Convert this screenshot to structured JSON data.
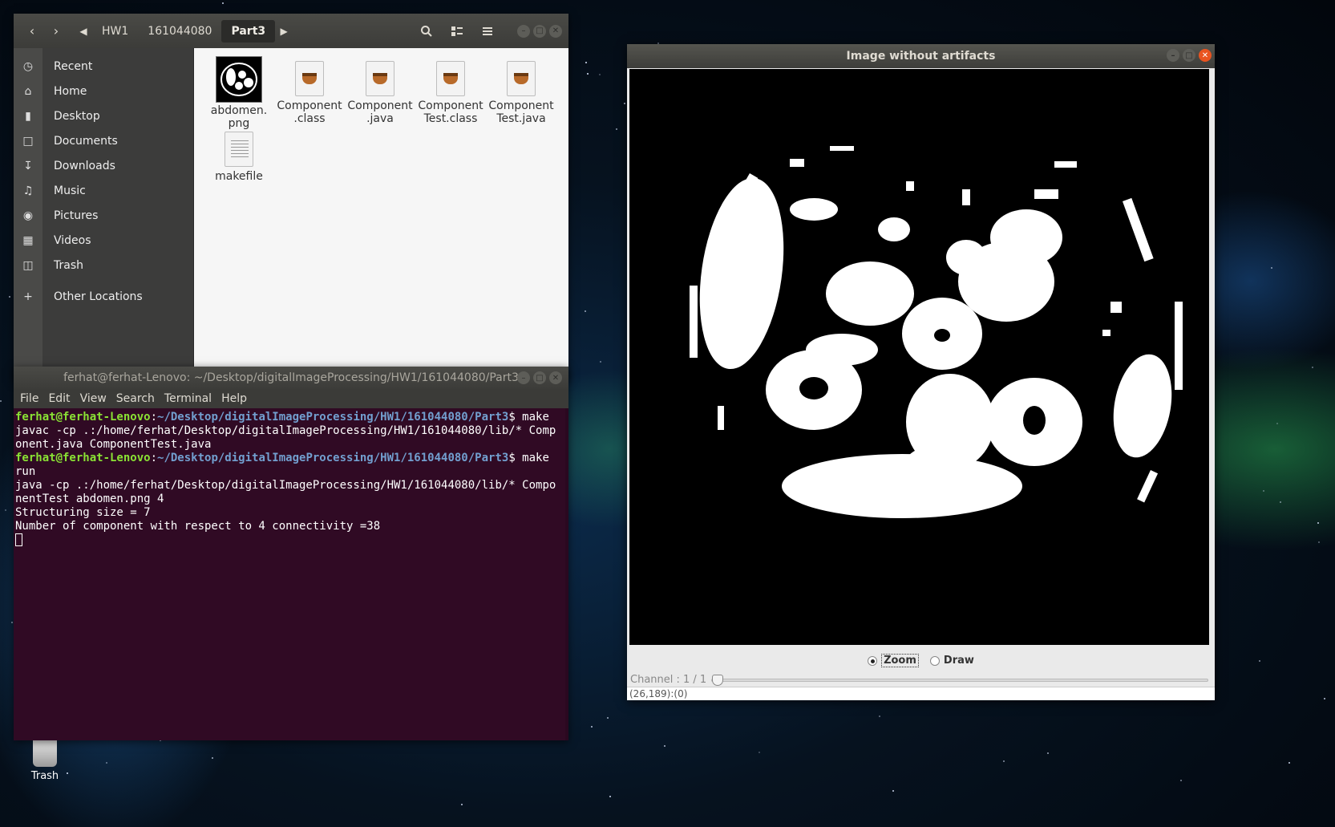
{
  "desktop": {
    "trash_label": "Trash"
  },
  "file_manager": {
    "breadcrumbs": [
      "HW1",
      "161044080",
      "Part3"
    ],
    "sidebar": [
      {
        "label": "Recent",
        "icon": "clock-icon"
      },
      {
        "label": "Home",
        "icon": "home-icon"
      },
      {
        "label": "Desktop",
        "icon": "folder-icon"
      },
      {
        "label": "Documents",
        "icon": "document-icon"
      },
      {
        "label": "Downloads",
        "icon": "download-icon"
      },
      {
        "label": "Music",
        "icon": "music-icon"
      },
      {
        "label": "Pictures",
        "icon": "camera-icon"
      },
      {
        "label": "Videos",
        "icon": "video-icon"
      },
      {
        "label": "Trash",
        "icon": "trash-icon"
      },
      {
        "label": "Other Locations",
        "icon": "plus-icon"
      }
    ],
    "files": [
      {
        "name": "abdomen.\npng",
        "kind": "image"
      },
      {
        "name": "Component\n.class",
        "kind": "java"
      },
      {
        "name": "Component\n.java",
        "kind": "java"
      },
      {
        "name": "Component\nTest.class",
        "kind": "java"
      },
      {
        "name": "Component\nTest.java",
        "kind": "java"
      },
      {
        "name": "makefile",
        "kind": "doc"
      }
    ]
  },
  "terminal": {
    "title": "ferhat@ferhat-Lenovo: ~/Desktop/digitalImageProcessing/HW1/161044080/Part3",
    "menu": [
      "File",
      "Edit",
      "View",
      "Search",
      "Terminal",
      "Help"
    ],
    "prompt_user": "ferhat@ferhat-Lenovo",
    "prompt_path": "~/Desktop/digitalImageProcessing/HW1/161044080/Part3",
    "cmd1": "$ make",
    "out1": "javac -cp .:/home/ferhat/Desktop/digitalImageProcessing/HW1/161044080/lib/* Comp\nonent.java ComponentTest.java",
    "cmd2": "$ make",
    "out2": "run\njava -cp .:/home/ferhat/Desktop/digitalImageProcessing/HW1/161044080/lib/* Compo\nnentTest abdomen.png 4\nStructuring size = 7\nNumber of component with respect to 4 connectivity =38"
  },
  "imagej": {
    "title": "Image without artifacts",
    "radio_zoom": "Zoom",
    "radio_draw": "Draw",
    "selected_mode": "Zoom",
    "channel_label": "Channel : 1 / 1",
    "status": "(26,189):(0)"
  },
  "colors": {
    "terminal_bg": "#300a24",
    "prompt_user": "#8ae234",
    "prompt_path": "#729fcf",
    "close_button": "#e95420"
  }
}
